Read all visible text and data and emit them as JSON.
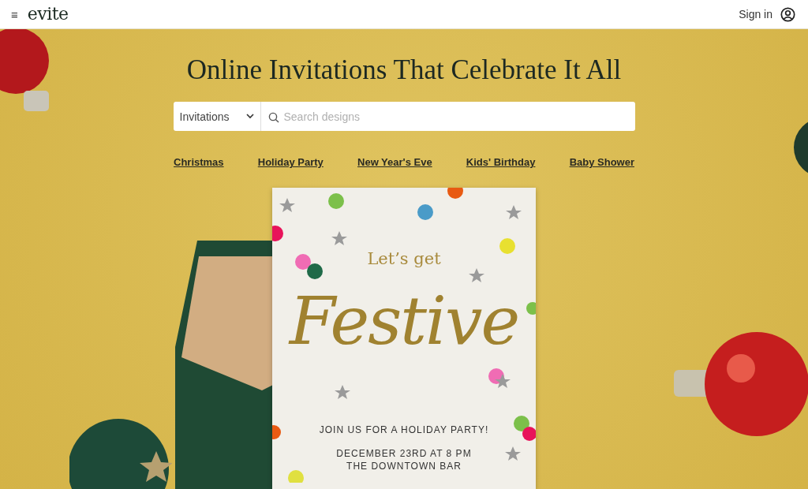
{
  "header": {
    "menu_icon": "≡",
    "logo": "evite",
    "sign_in": "Sign in"
  },
  "hero": {
    "title": "Online Invitations That Celebrate It All"
  },
  "search": {
    "category": "Invitations",
    "placeholder": "Search designs"
  },
  "categories": [
    "Christmas",
    "Holiday Party",
    "New Year's Eve",
    "Kids' Birthday",
    "Baby Shower"
  ],
  "invitation": {
    "intro": "Let’s get",
    "headline": "Festive",
    "lines": [
      "JOIN US FOR A HOLIDAY PARTY!",
      "DECEMBER 23RD AT 8 PM",
      "THE DOWNTOWN BAR"
    ]
  }
}
